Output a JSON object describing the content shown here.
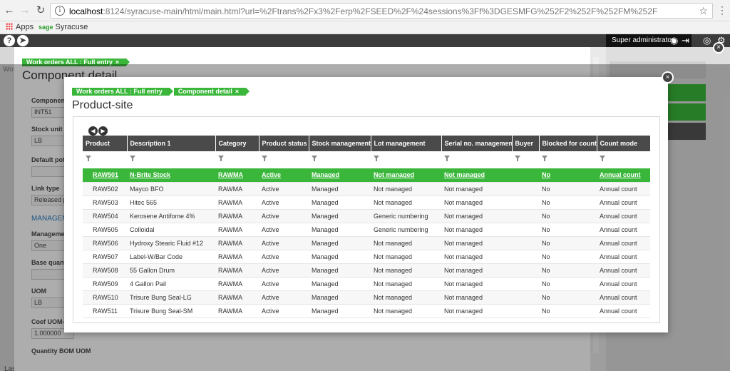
{
  "browser": {
    "url_host": "localhost",
    "url_rest": ":8124/syracuse-main/html/main.html?url=%2Ftrans%2Fx3%2Ferp%2FSEED%2F%24sessions%3Ff%3DGESMFG%252F2%252F%252FM%252F",
    "bookmarks": [
      "Apps",
      "Syracuse"
    ],
    "sage_label": "sage"
  },
  "header": {
    "user": "Super administrator"
  },
  "background": {
    "crumb": "Work orders ALL : Full entry",
    "title": "Component detail",
    "fields": [
      {
        "label": "Component",
        "value": "INT51"
      },
      {
        "label": "Stock unit",
        "value": "LB"
      },
      {
        "label": "Default pot",
        "value": ""
      },
      {
        "label": "Link type",
        "value": "Released p"
      },
      {
        "label": "Management",
        "value": "One"
      },
      {
        "label": "Base quant",
        "value": ""
      },
      {
        "label": "UOM",
        "value": "LB"
      },
      {
        "label": "Coef UOM-",
        "value": "1.000000"
      },
      {
        "label": "Quantity BOM UOM",
        "value": ""
      }
    ],
    "link": "MANAGEM",
    "side_label": "Wo",
    "footer_label": "Last read"
  },
  "modal": {
    "crumbs": [
      "Work orders ALL : Full entry",
      "Component detail"
    ],
    "title": "Product-site",
    "columns": [
      "Product",
      "Description 1",
      "Category",
      "Product status",
      "Stock management",
      "Lot management",
      "Serial no. management",
      "Buyer",
      "Blocked for count",
      "Count mode"
    ],
    "rows": [
      [
        "RAW501",
        "N-Brite Stock",
        "RAWMA",
        "Active",
        "Managed",
        "Not managed",
        "Not managed",
        "",
        "No",
        "Annual count"
      ],
      [
        "RAW502",
        "Mayco BFO",
        "RAWMA",
        "Active",
        "Managed",
        "Not managed",
        "Not managed",
        "",
        "No",
        "Annual count"
      ],
      [
        "RAW503",
        "Hitec 565",
        "RAWMA",
        "Active",
        "Managed",
        "Not managed",
        "Not managed",
        "",
        "No",
        "Annual count"
      ],
      [
        "RAW504",
        "Kerosene Antifome 4%",
        "RAWMA",
        "Active",
        "Managed",
        "Generic numbering",
        "Not managed",
        "",
        "No",
        "Annual count"
      ],
      [
        "RAW505",
        "Colloidal",
        "RAWMA",
        "Active",
        "Managed",
        "Generic numbering",
        "Not managed",
        "",
        "No",
        "Annual count"
      ],
      [
        "RAW506",
        "Hydroxy Stearic Fluid #12",
        "RAWMA",
        "Active",
        "Managed",
        "Not managed",
        "Not managed",
        "",
        "No",
        "Annual count"
      ],
      [
        "RAW507",
        "Label-W/Bar Code",
        "RAWMA",
        "Active",
        "Managed",
        "Not managed",
        "Not managed",
        "",
        "No",
        "Annual count"
      ],
      [
        "RAW508",
        "55 Gallon Drum",
        "RAWMA",
        "Active",
        "Managed",
        "Not managed",
        "Not managed",
        "",
        "No",
        "Annual count"
      ],
      [
        "RAW509",
        "4 Gallon Pail",
        "RAWMA",
        "Active",
        "Managed",
        "Not managed",
        "Not managed",
        "",
        "No",
        "Annual count"
      ],
      [
        "RAW510",
        "Trisure Bung Seal-LG",
        "RAWMA",
        "Active",
        "Managed",
        "Not managed",
        "Not managed",
        "",
        "No",
        "Annual count"
      ],
      [
        "RAW511",
        "Trisure Bung Seal-SM",
        "RAWMA",
        "Active",
        "Managed",
        "Not managed",
        "Not managed",
        "",
        "No",
        "Annual count"
      ]
    ],
    "selected_row": 0
  },
  "colors": {
    "accent_green": "#3ab73a",
    "header_dark": "#3c3c3c",
    "grid_header": "#4a4a4a"
  }
}
